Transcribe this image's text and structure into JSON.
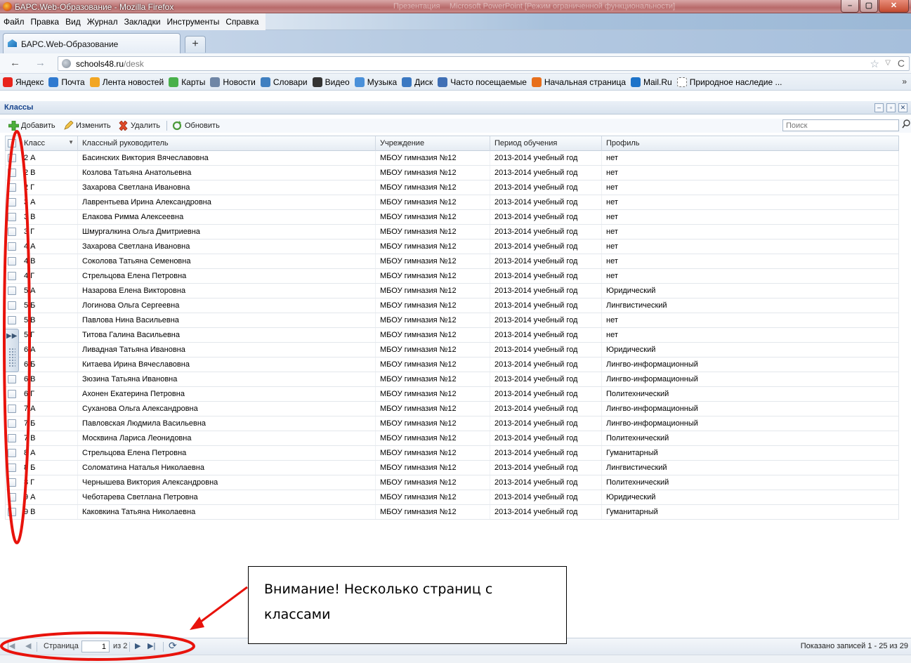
{
  "window": {
    "title": "БАРС.Web-Образование - Mozilla Firefox",
    "bg_titles": [
      "Презентация",
      "Microsoft PowerPoint [Режим ограниченной функциональности]"
    ],
    "controls": [
      "–",
      "▢",
      "✕"
    ]
  },
  "menu": [
    "Файл",
    "Правка",
    "Вид",
    "Журнал",
    "Закладки",
    "Инструменты",
    "Справка"
  ],
  "tab": {
    "label": "БАРС.Web-Образование",
    "new_tab": "+"
  },
  "nav": {
    "back": "←",
    "forward": "→",
    "url_host": "schools48.ru",
    "url_path": "/desk",
    "star": "☆",
    "dropdown": "▽",
    "reload": "C"
  },
  "bookmarks": [
    {
      "label": "Яндекс",
      "color": "#e8241c"
    },
    {
      "label": "Почта",
      "color": "#2f7ad0"
    },
    {
      "label": "Лента новостей",
      "color": "#f2a623"
    },
    {
      "label": "Карты",
      "color": "#48b04a"
    },
    {
      "label": "Новости",
      "color": "#6f86a6"
    },
    {
      "label": "Словари",
      "color": "#3f7fc0"
    },
    {
      "label": "Видео",
      "color": "#333333"
    },
    {
      "label": "Музыка",
      "color": "#4a90d9"
    },
    {
      "label": "Диск",
      "color": "#3a78c2"
    },
    {
      "label": "Часто посещаемые",
      "color": "#3f6fb5"
    },
    {
      "label": "Начальная страница",
      "color": "#e76f1c"
    },
    {
      "label": "Mail.Ru",
      "color": "#1d73c9"
    },
    {
      "label": "Природное наследие ...",
      "color": "#ffffff"
    }
  ],
  "bookmarks_more": "»",
  "panel": {
    "title": "Классы",
    "controls": [
      "–",
      "▫",
      "✕"
    ],
    "toolbar": {
      "add": "Добавить",
      "edit": "Изменить",
      "delete": "Удалить",
      "refresh": "Обновить"
    },
    "search_placeholder": "Поиск"
  },
  "columns": [
    "Класс",
    "Классный руководитель",
    "Учреждение",
    "Период обучения",
    "Профиль"
  ],
  "rows": [
    [
      "2 А",
      "Басинских Виктория Вячеславовна",
      "МБОУ гимназия №12",
      "2013-2014 учебный год",
      "нет"
    ],
    [
      "2 В",
      "Козлова Татьяна Анатольевна",
      "МБОУ гимназия №12",
      "2013-2014 учебный год",
      "нет"
    ],
    [
      "2 Г",
      "Захарова Светлана Ивановна",
      "МБОУ гимназия №12",
      "2013-2014 учебный год",
      "нет"
    ],
    [
      "3 А",
      "Лаврентьева Ирина Александровна",
      "МБОУ гимназия №12",
      "2013-2014 учебный год",
      "нет"
    ],
    [
      "3 В",
      "Елакова Римма Алексеевна",
      "МБОУ гимназия №12",
      "2013-2014 учебный год",
      "нет"
    ],
    [
      "3 Г",
      "Шмургалкина Ольга Дмитриевна",
      "МБОУ гимназия №12",
      "2013-2014 учебный год",
      "нет"
    ],
    [
      "4 А",
      "Захарова Светлана Ивановна",
      "МБОУ гимназия №12",
      "2013-2014 учебный год",
      "нет"
    ],
    [
      "4 В",
      "Соколова Татьяна Семеновна",
      "МБОУ гимназия №12",
      "2013-2014 учебный год",
      "нет"
    ],
    [
      "4 Г",
      "Стрельцова Елена Петровна",
      "МБОУ гимназия №12",
      "2013-2014 учебный год",
      "нет"
    ],
    [
      "5 А",
      "Назарова Елена Викторовна",
      "МБОУ гимназия №12",
      "2013-2014 учебный год",
      "Юридический"
    ],
    [
      "5 Б",
      "Логинова Ольга Сергеевна",
      "МБОУ гимназия №12",
      "2013-2014 учебный год",
      "Лингвистический"
    ],
    [
      "5 В",
      "Павлова Нина Васильевна",
      "МБОУ гимназия №12",
      "2013-2014 учебный год",
      "нет"
    ],
    [
      "5 Г",
      "Титова Галина Васильевна",
      "МБОУ гимназия №12",
      "2013-2014 учебный год",
      "нет"
    ],
    [
      "6 А",
      "Ливадная Татьяна Ивановна",
      "МБОУ гимназия №12",
      "2013-2014 учебный год",
      "Юридический"
    ],
    [
      "6 Б",
      "Китаева Ирина Вячеславовна",
      "МБОУ гимназия №12",
      "2013-2014 учебный год",
      "Лингво-информационный"
    ],
    [
      "6 В",
      "Зюзина Татьяна Ивановна",
      "МБОУ гимназия №12",
      "2013-2014 учебный год",
      "Лингво-информационный"
    ],
    [
      "6 Г",
      "Ахонен Екатерина Петровна",
      "МБОУ гимназия №12",
      "2013-2014 учебный год",
      "Политехнический"
    ],
    [
      "7 А",
      "Суханова Ольга Александровна",
      "МБОУ гимназия №12",
      "2013-2014 учебный год",
      "Лингво-информационный"
    ],
    [
      "7 Б",
      "Павловская Людмила Васильевна",
      "МБОУ гимназия №12",
      "2013-2014 учебный год",
      "Лингво-информационный"
    ],
    [
      "7 В",
      "Москвина Лариса Леонидовна",
      "МБОУ гимназия №12",
      "2013-2014 учебный год",
      "Политехнический"
    ],
    [
      "8 А",
      "Стрельцова Елена Петровна",
      "МБОУ гимназия №12",
      "2013-2014 учебный год",
      "Гуманитарный"
    ],
    [
      "8 Б",
      "Соломатина Наталья Николаевна",
      "МБОУ гимназия №12",
      "2013-2014 учебный год",
      "Лингвистический"
    ],
    [
      "8 Г",
      "Чернышева Виктория Александровна",
      "МБОУ гимназия №12",
      "2013-2014 учебный год",
      "Политехнический"
    ],
    [
      "9 А",
      "Чеботарева Светлана Петровна",
      "МБОУ гимназия №12",
      "2013-2014 учебный год",
      "Юридический"
    ],
    [
      "9 В",
      "Каковкина Татьяна Николаевна",
      "МБОУ гимназия №12",
      "2013-2014 учебный год",
      "Гуманитарный"
    ]
  ],
  "pager": {
    "page_label": "Страница",
    "page": "1",
    "of": "из 2",
    "info": "Показано записей 1 - 25 из 29"
  },
  "annotation": {
    "line1": "Внимание! Несколько страниц с",
    "line2": "классами",
    "color": "#e8130c"
  }
}
